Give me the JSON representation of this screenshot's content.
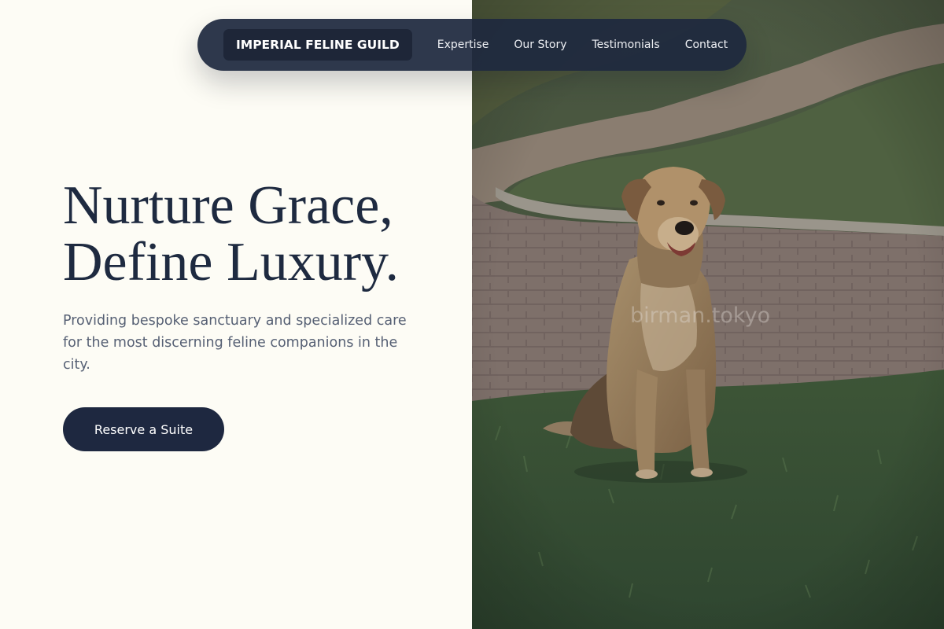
{
  "nav": {
    "brand": "IMPERIAL FELINE GUILD",
    "links": [
      {
        "label": "Expertise"
      },
      {
        "label": "Our Story"
      },
      {
        "label": "Testimonials"
      },
      {
        "label": "Contact"
      }
    ]
  },
  "hero": {
    "title_line1": "Nurture Grace,",
    "title_line2": "Define Luxury.",
    "subtitle": "Providing bespoke sanctuary and specialized care for the most discerning feline companions in the city.",
    "cta_label": "Reserve a Suite"
  },
  "photo": {
    "subject": "dog sitting on grass beside a brick path",
    "watermark": "birman.tokyo"
  },
  "colors": {
    "page_background": "#fdfcf5",
    "navy": "#1e2840",
    "body_text": "#566074",
    "nav_link": "#eef0f4"
  }
}
